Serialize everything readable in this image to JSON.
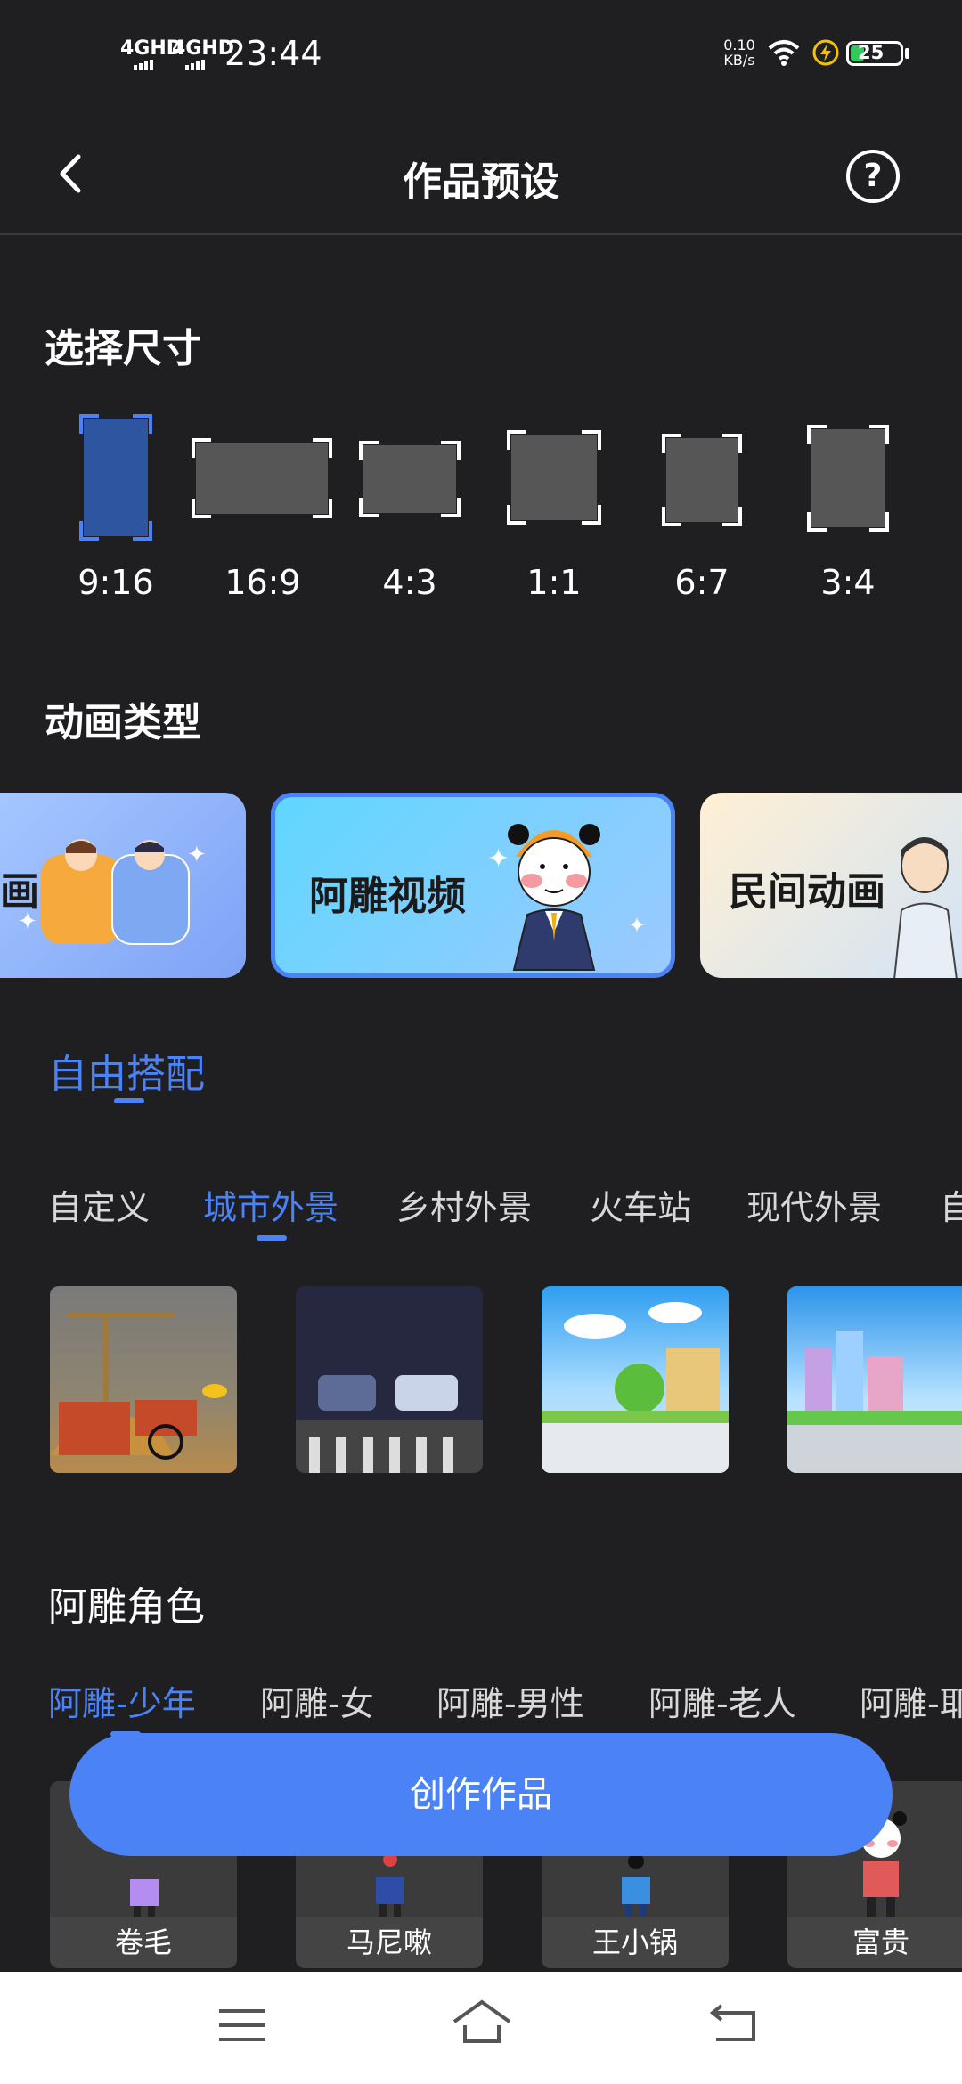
{
  "status_bar": {
    "net1": "4GHD",
    "net2": "4GHD",
    "time": "23:44",
    "speed_value": "0.10",
    "speed_unit": "KB/s",
    "battery": "25"
  },
  "header": {
    "title": "作品预设",
    "help": "?"
  },
  "size_section": {
    "title": "选择尺寸",
    "options": [
      "9:16",
      "16:9",
      "4:3",
      "1:1",
      "6:7",
      "3:4"
    ],
    "selected": "9:16"
  },
  "animation_section": {
    "title": "动画类型",
    "cards": [
      "画",
      "阿雕视频",
      "民间动画"
    ],
    "selected": "阿雕视频"
  },
  "free_match": {
    "title": "自由搭配",
    "scene_tabs": [
      "自定义",
      "城市外景",
      "乡村外景",
      "火车站",
      "现代外景",
      "自"
    ],
    "active_scene_tab": "城市外景"
  },
  "role_section": {
    "title": "阿雕角色",
    "tabs": [
      "阿雕-少年",
      "阿雕-女",
      "阿雕-男性",
      "阿雕-老人",
      "阿雕-耶"
    ],
    "active_tab": "阿雕-少年",
    "characters": [
      "卷毛",
      "马尼嗽",
      "王小锅",
      "富贵"
    ]
  },
  "create_button": "创作作品",
  "colors": {
    "accent": "#4b82f5",
    "background": "#1f1f21",
    "frame": "#565656"
  }
}
